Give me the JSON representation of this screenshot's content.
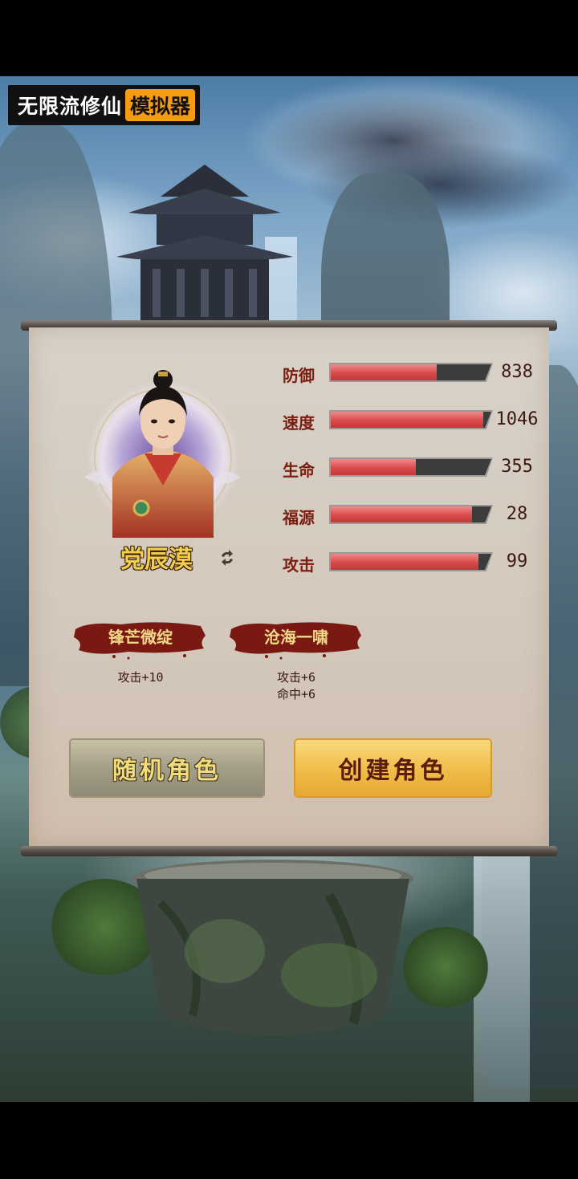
{
  "app": {
    "title_main": "无限流修仙",
    "title_tag": "模拟器"
  },
  "character": {
    "name": "党辰漠",
    "stats": [
      {
        "label": "防御",
        "value": "838",
        "fill": 0.66
      },
      {
        "label": "速度",
        "value": "1046",
        "fill": 0.95
      },
      {
        "label": "生命",
        "value": "355",
        "fill": 0.53
      },
      {
        "label": "福源",
        "value": "28",
        "fill": 0.88
      },
      {
        "label": "攻击",
        "value": "99",
        "fill": 0.92
      }
    ],
    "skills": [
      {
        "name": "锋芒微绽",
        "effects": [
          "攻击+10"
        ]
      },
      {
        "name": "沧海一啸",
        "effects": [
          "攻击+6",
          "命中+6"
        ]
      }
    ]
  },
  "actions": {
    "random_label": "随机角色",
    "create_label": "创建角色"
  },
  "colors": {
    "stat_fill": "#d94a4a",
    "stat_label": "#7a1e10",
    "create_button": "#f2bf4c",
    "title_tag_bg": "#f59c12"
  },
  "icons": {
    "refresh": "refresh-icon"
  }
}
